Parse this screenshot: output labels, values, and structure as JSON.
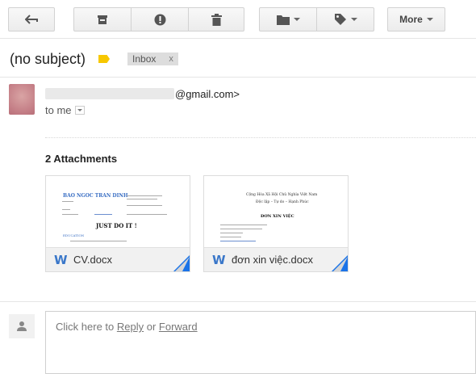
{
  "toolbar": {
    "back_icon": "back-arrow-icon",
    "archive_icon": "archive-icon",
    "spam_icon": "report-spam-icon",
    "delete_icon": "trash-icon",
    "move_icon": "folder-icon",
    "labels_icon": "label-icon",
    "more_label": "More"
  },
  "message": {
    "subject": "(no subject)",
    "label_chip": "Inbox",
    "label_chip_close": "x",
    "sender_email_tail": "@gmail.com>",
    "recipient": "to me"
  },
  "attachments": {
    "title": "2 Attachments",
    "items": [
      {
        "filename": "CV.docx",
        "preview": {
          "name": "BAO NGOC TRAN DINH",
          "motto": "JUST DO IT !",
          "section": "EDUCATION"
        }
      },
      {
        "filename": "đơn xin việc.docx",
        "preview": {
          "header1": "Cộng Hòa Xã Hội Chủ Nghĩa Việt Nam",
          "header2": "Độc lập – Tự do – Hạnh Phúc",
          "title": "ĐƠN XIN VIỆC"
        }
      }
    ]
  },
  "reply": {
    "prefix": "Click here to ",
    "reply_link": "Reply",
    "or_text": " or ",
    "forward_link": "Forward"
  },
  "colors": {
    "word_blue": "#3a77c9",
    "label_yellow": "#f7c700",
    "corner_blue": "#1a73e8"
  }
}
